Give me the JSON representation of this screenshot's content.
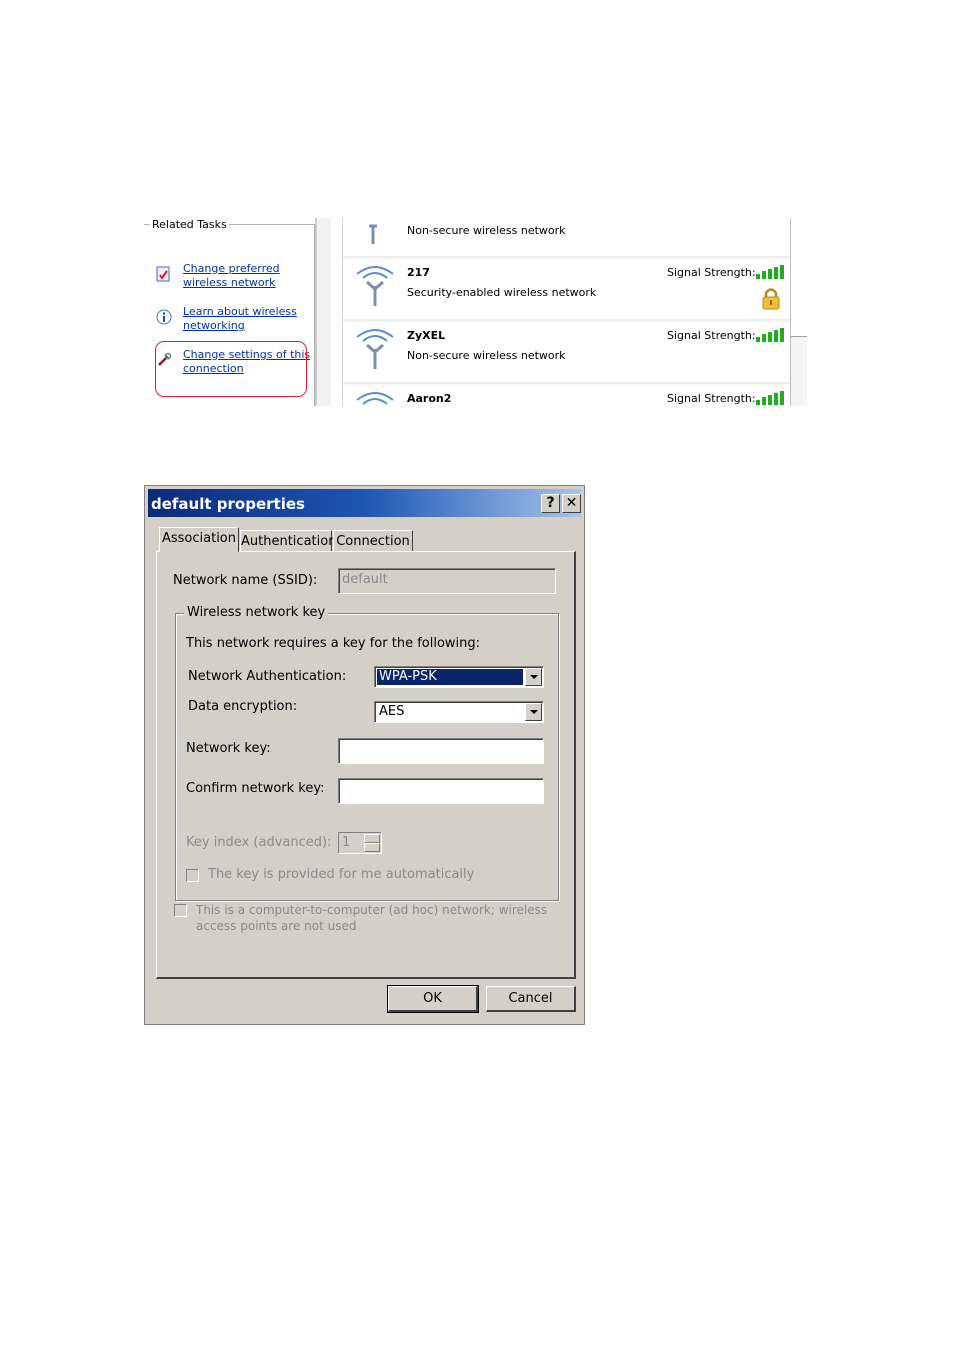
{
  "related_tasks": {
    "title": "Related Tasks",
    "items": [
      {
        "label": "Change preferred wireless network",
        "icon": "checklist-icon"
      },
      {
        "label": "Learn about wireless networking",
        "icon": "info-icon"
      },
      {
        "label": "Change settings of this connection",
        "icon": "settings-tools-icon"
      }
    ]
  },
  "networks": [
    {
      "name": "",
      "description": "Non-secure wireless network",
      "signal_label": "",
      "secured": false
    },
    {
      "name": "217",
      "description": "Security-enabled wireless network",
      "signal_label": "Signal Strength:",
      "secured": true
    },
    {
      "name": "ZyXEL",
      "description": "Non-secure wireless network",
      "signal_label": "Signal Strength:",
      "secured": false
    },
    {
      "name": "Aaron2",
      "description": "",
      "signal_label": "Signal Strength:",
      "secured": false
    }
  ],
  "dialog": {
    "title": "default properties",
    "help_button": "?",
    "close_button": "✕",
    "tabs": [
      "Association",
      "Authentication",
      "Connection"
    ],
    "active_tab": "Association",
    "ssid_label": "Network name (SSID):",
    "ssid_value": "default",
    "group_title": "Wireless network key",
    "requires_text": "This network requires a key for the following:",
    "auth_label": "Network Authentication:",
    "auth_value": "WPA-PSK",
    "enc_label": "Data encryption:",
    "enc_value": "AES",
    "key_label": "Network key:",
    "key_value": "",
    "confirm_label": "Confirm network key:",
    "confirm_value": "",
    "key_index_label": "Key index (advanced):",
    "key_index_value": "1",
    "auto_key_label": "The key is provided for me automatically",
    "adhoc_line1": "This is a computer-to-computer (ad hoc) network; wireless",
    "adhoc_line2": "access points are not used",
    "ok_label": "OK",
    "cancel_label": "Cancel"
  },
  "colors": {
    "title_bar": "#0a2a7a",
    "link": "#0033aa",
    "highlight_circle": "#e0202c",
    "signal_bars": "#1fae1f",
    "selection": "#0a246a"
  }
}
